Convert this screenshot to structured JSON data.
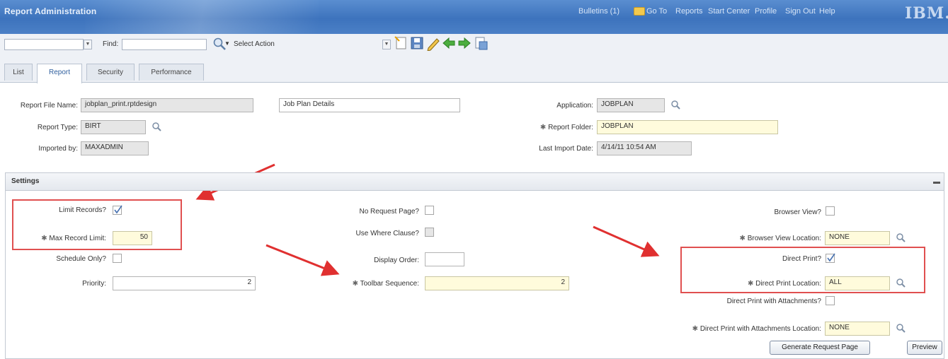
{
  "header": {
    "app_title": "Report Administration",
    "bulletins": "Bulletins (1)",
    "goto": "Go To",
    "reports": "Reports",
    "start_center": "Start Center",
    "profile": "Profile",
    "sign_out": "Sign Out",
    "help": "Help",
    "logo": "IBM."
  },
  "toolbar": {
    "find_label": "Find:",
    "select_action": "Select Action"
  },
  "tabs": [
    "List",
    "Report",
    "Security",
    "Performance"
  ],
  "report": {
    "file_name_label": "Report File Name:",
    "file_name": "jobplan_print.rptdesign",
    "description": "Job Plan Details",
    "application_label": "Application:",
    "application": "JOBPLAN",
    "type_label": "Report Type:",
    "type": "BIRT",
    "folder_label": "Report Folder:",
    "folder": "JOBPLAN",
    "imported_by_label": "Imported by:",
    "imported_by": "MAXADMIN",
    "last_import_label": "Last Import Date:",
    "last_import": "4/14/11 10:54 AM"
  },
  "settings": {
    "title": "Settings",
    "limit_records_label": "Limit Records?",
    "limit_records": true,
    "max_record_limit_label": "Max Record Limit:",
    "max_record_limit": "50",
    "schedule_only_label": "Schedule Only?",
    "priority_label": "Priority:",
    "priority": "2",
    "no_request_page_label": "No Request Page?",
    "use_where_clause_label": "Use Where Clause?",
    "display_order_label": "Display Order:",
    "toolbar_sequence_label": "Toolbar Sequence:",
    "toolbar_sequence": "2",
    "browser_view_label": "Browser View?",
    "browser_view_location_label": "Browser View Location:",
    "browser_view_location": "NONE",
    "direct_print_label": "Direct Print?",
    "direct_print": true,
    "direct_print_location_label": "Direct Print Location:",
    "direct_print_location": "ALL",
    "direct_print_attachments_label": "Direct Print with Attachments?",
    "direct_print_attachments_location_label": "Direct Print with Attachments Location:",
    "direct_print_attachments_location": "NONE"
  },
  "buttons": {
    "generate_request_page": "Generate Request Page",
    "preview": "Preview"
  },
  "colors": {
    "header_blue": "#3d73bd",
    "required_yellow": "#fffbdc",
    "annotation_red": "#e03030"
  }
}
